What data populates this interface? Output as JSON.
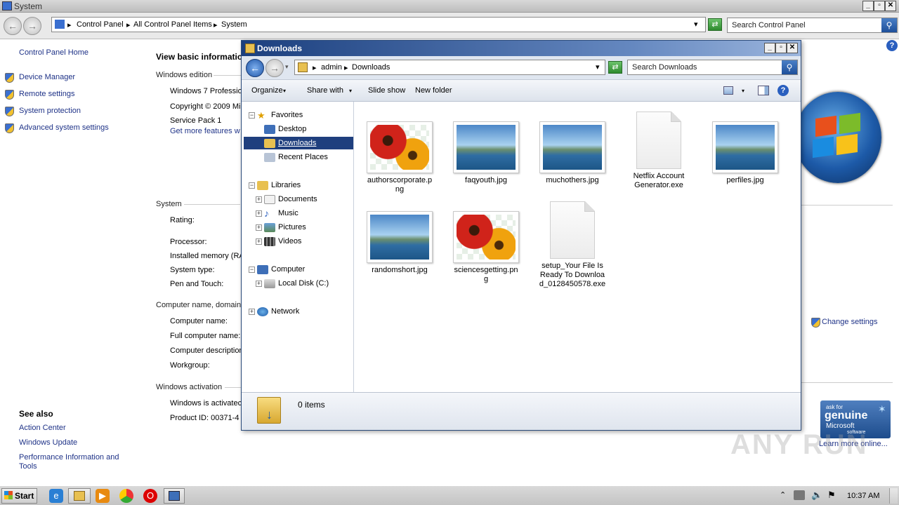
{
  "system_window": {
    "title": "System",
    "breadcrumbs": [
      "Control Panel",
      "All Control Panel Items",
      "System"
    ],
    "search_placeholder": "Search Control Panel"
  },
  "sidebar": {
    "home": "Control Panel Home",
    "items": [
      "Device Manager",
      "Remote settings",
      "System protection",
      "Advanced system settings"
    ],
    "see_also_title": "See also",
    "see_also": [
      "Action Center",
      "Windows Update",
      "Performance Information and Tools"
    ]
  },
  "main": {
    "heading": "View basic informatio",
    "edition_title": "Windows edition",
    "edition_lines": [
      "Windows 7 Professio",
      "Copyright © 2009 Mi",
      "Service Pack 1"
    ],
    "more_features": "Get more features w",
    "system_title": "System",
    "system_labels": [
      "Rating:",
      "Processor:",
      "Installed memory (RA",
      "System type:",
      "Pen and Touch:"
    ],
    "computer_title": "Computer name, domain,",
    "computer_labels": [
      "Computer name:",
      "Full computer name:",
      "Computer description",
      "Workgroup:"
    ],
    "change_settings": "Change settings",
    "activation_title": "Windows activation",
    "activated_text": "Windows is activatec",
    "product_id": "Product ID:  00371-4",
    "genuine_lines": [
      "ask for",
      "genuine",
      "Microsoft",
      "software"
    ],
    "learn_more": "Learn more online..."
  },
  "downloads_window": {
    "title": "Downloads",
    "breadcrumbs": [
      "admin",
      "Downloads"
    ],
    "search_placeholder": "Search Downloads",
    "commands": [
      "Organize",
      "Share with",
      "Slide show",
      "New folder"
    ],
    "tree": {
      "favorites": "Favorites",
      "desktop": "Desktop",
      "downloads": "Downloads",
      "recent": "Recent Places",
      "libraries": "Libraries",
      "documents": "Documents",
      "music": "Music",
      "pictures": "Pictures",
      "videos": "Videos",
      "computer": "Computer",
      "local_disk": "Local Disk (C:)",
      "network": "Network"
    },
    "files": [
      {
        "name": "authorscorporate.png",
        "kind": "flower"
      },
      {
        "name": "faqyouth.jpg",
        "kind": "land"
      },
      {
        "name": "muchothers.jpg",
        "kind": "land"
      },
      {
        "name": "Netflix Account Generator.exe",
        "kind": "exe"
      },
      {
        "name": "perfiles.jpg",
        "kind": "land"
      },
      {
        "name": "randomshort.jpg",
        "kind": "land"
      },
      {
        "name": "sciencesgetting.png",
        "kind": "flower"
      },
      {
        "name": "setup_Your File Is Ready To Download_0128450578.exe",
        "kind": "exe"
      }
    ],
    "status": "0 items"
  },
  "taskbar": {
    "start": "Start",
    "clock": "10:37 AM"
  },
  "watermark": "ANY RUN"
}
